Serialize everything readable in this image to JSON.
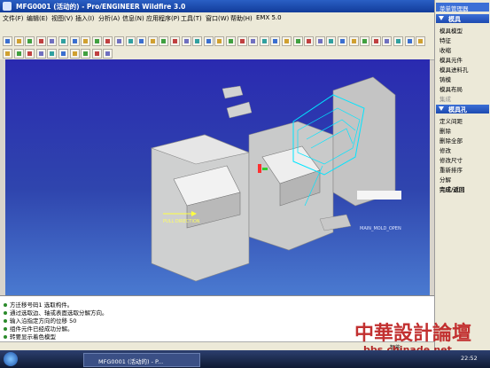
{
  "window": {
    "title": "MFG0001 (活动的) - Pro/ENGINEER Wildfire 3.0"
  },
  "menu": {
    "items": [
      "文件(F)",
      "编辑(E)",
      "视图(V)",
      "插入(I)",
      "分析(A)",
      "信息(N)",
      "应用程序(P)",
      "工具(T)",
      "窗口(W)",
      "帮助(H)",
      "EMX 5.0"
    ]
  },
  "manager": {
    "title": "菜单管理器"
  },
  "mold_menu": {
    "title": "模具",
    "items": [
      {
        "label": "模具模型",
        "enabled": true
      },
      {
        "label": "特征",
        "enabled": true
      },
      {
        "label": "收缩",
        "enabled": true
      },
      {
        "label": "模具元件",
        "enabled": true
      },
      {
        "label": "模具进料孔",
        "enabled": true
      },
      {
        "label": "铸模",
        "enabled": true
      },
      {
        "label": "模具布局",
        "enabled": true
      },
      {
        "label": "集成",
        "enabled": false
      }
    ]
  },
  "mold_hole_menu": {
    "title": "模具孔",
    "items": [
      {
        "label": "定义间距"
      },
      {
        "label": "删除"
      },
      {
        "label": "删除全部"
      },
      {
        "label": "修改"
      },
      {
        "label": "修改尺寸"
      },
      {
        "label": "重新排序"
      },
      {
        "label": "分解"
      },
      {
        "label": "完成/返回"
      }
    ]
  },
  "viewport": {
    "pull_direction": "PULL DIRECTION",
    "model_label": "MAIN_MOLD_OPEN"
  },
  "messages": [
    "方迁移号码1 选取构件。",
    "通过选取边、轴或表面选取分解方向。",
    "输入沿指定方向的位移  50",
    "组件元件已经成功分解。",
    "转要显示着色模型"
  ],
  "status": {
    "filter": "智能"
  },
  "taskbar": {
    "app_button": "MFG0001 (活动的) - P...",
    "clock": "22:52"
  },
  "watermark": {
    "text": "中華設計論壇",
    "url": "bbs.chinade.net"
  },
  "colors": {
    "viewport_bg": "#2f45ae",
    "menu_header": "#1d4ab0",
    "selection": "#00e5ff"
  }
}
